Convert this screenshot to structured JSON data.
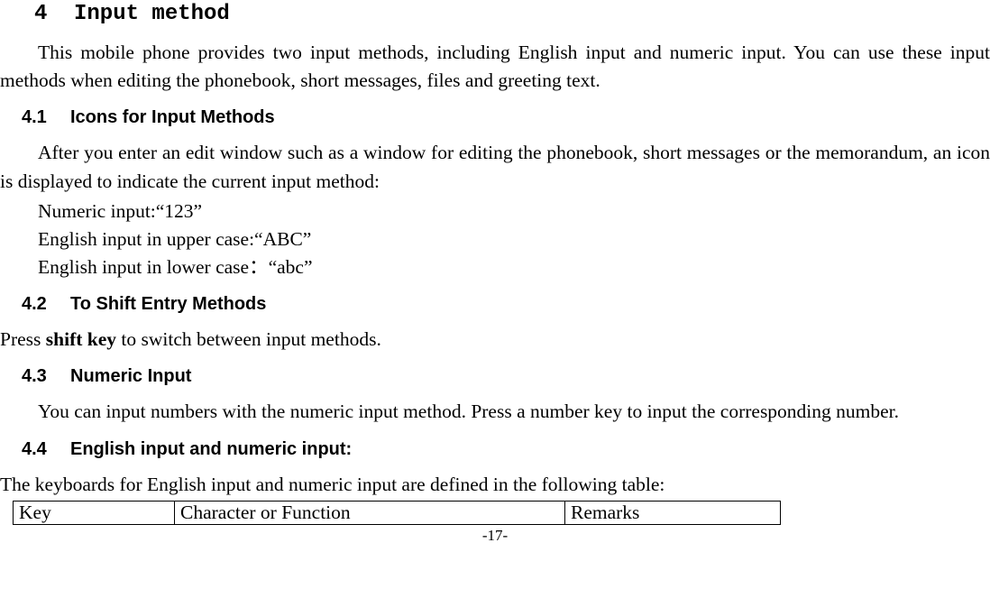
{
  "h1": {
    "num": "4",
    "title": "Input method"
  },
  "intro": "This mobile phone provides two input methods, including English input and numeric input. You can use these input methods when editing the phonebook, short messages, files and greeting text.",
  "s41": {
    "num": "4.1",
    "title": "Icons for Input Methods",
    "lead": "After you enter an edit window such as a window for editing the phonebook, short messages or the memorandum, an icon is displayed to indicate the current input method:",
    "lines": [
      "Numeric input:“123”",
      "English input in upper case:“ABC”",
      "English input in lower case：“abc”"
    ]
  },
  "s42": {
    "num": "4.2",
    "title": "To Shift Entry Methods",
    "line_pre": "Press ",
    "line_bold": "shift key",
    "line_post": " to switch between input methods."
  },
  "s43": {
    "num": "4.3",
    "title": "Numeric Input",
    "para": "You can input numbers with the numeric input method. Press a number key to input the corresponding number."
  },
  "s44": {
    "num": "4.4",
    "title": "English input and numeric input:",
    "lead": "The keyboards for English input and numeric input are defined in the following table:",
    "table_headers": {
      "c1": "Key",
      "c2": "Character or Function",
      "c3": "Remarks"
    }
  },
  "page_number": "-17-"
}
